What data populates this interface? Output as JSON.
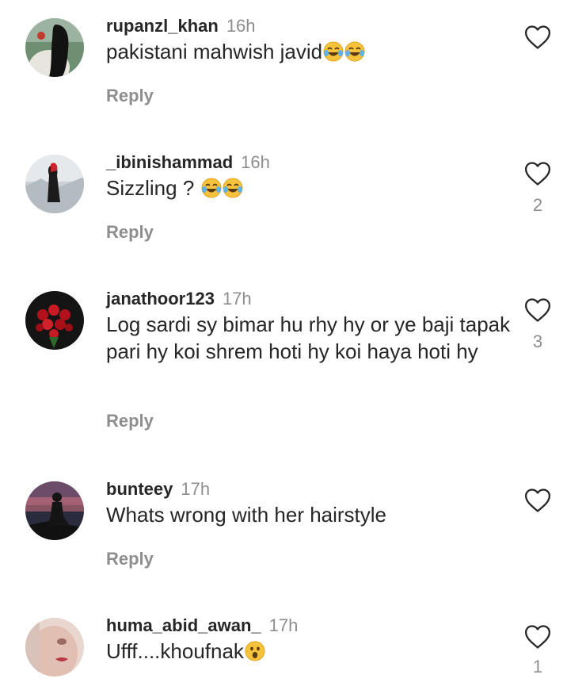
{
  "comments": [
    {
      "username": "rupanzl_khan",
      "time": "16h",
      "text": "pakistani mahwish javid",
      "emojis": [
        "tears-of-joy",
        "tears-of-joy"
      ],
      "reply": "Reply",
      "likes": ""
    },
    {
      "username": "_ibinishammad",
      "time": "16h",
      "text": "Sizzling ? ",
      "emojis": [
        "tears-of-joy",
        "tears-of-joy"
      ],
      "reply": "Reply",
      "likes": "2"
    },
    {
      "username": "janathoor123",
      "time": "17h",
      "text": "Log sardi sy bimar hu rhy hy or ye baji tapak pari hy koi shrem hoti hy koi haya hoti hy",
      "emojis": [],
      "reply": "Reply",
      "likes": "3"
    },
    {
      "username": "bunteey",
      "time": "17h",
      "text": "Whats wrong with her hairstyle",
      "emojis": [],
      "reply": "Reply",
      "likes": ""
    },
    {
      "username": "huma_abid_awan_",
      "time": "17h",
      "text": "Ufff....khoufnak",
      "emojis": [
        "astonished"
      ],
      "reply": "",
      "likes": "1"
    }
  ],
  "colors": {
    "username": "#262626",
    "secondary": "#8e8e8e",
    "heart_outline": "#262626"
  }
}
